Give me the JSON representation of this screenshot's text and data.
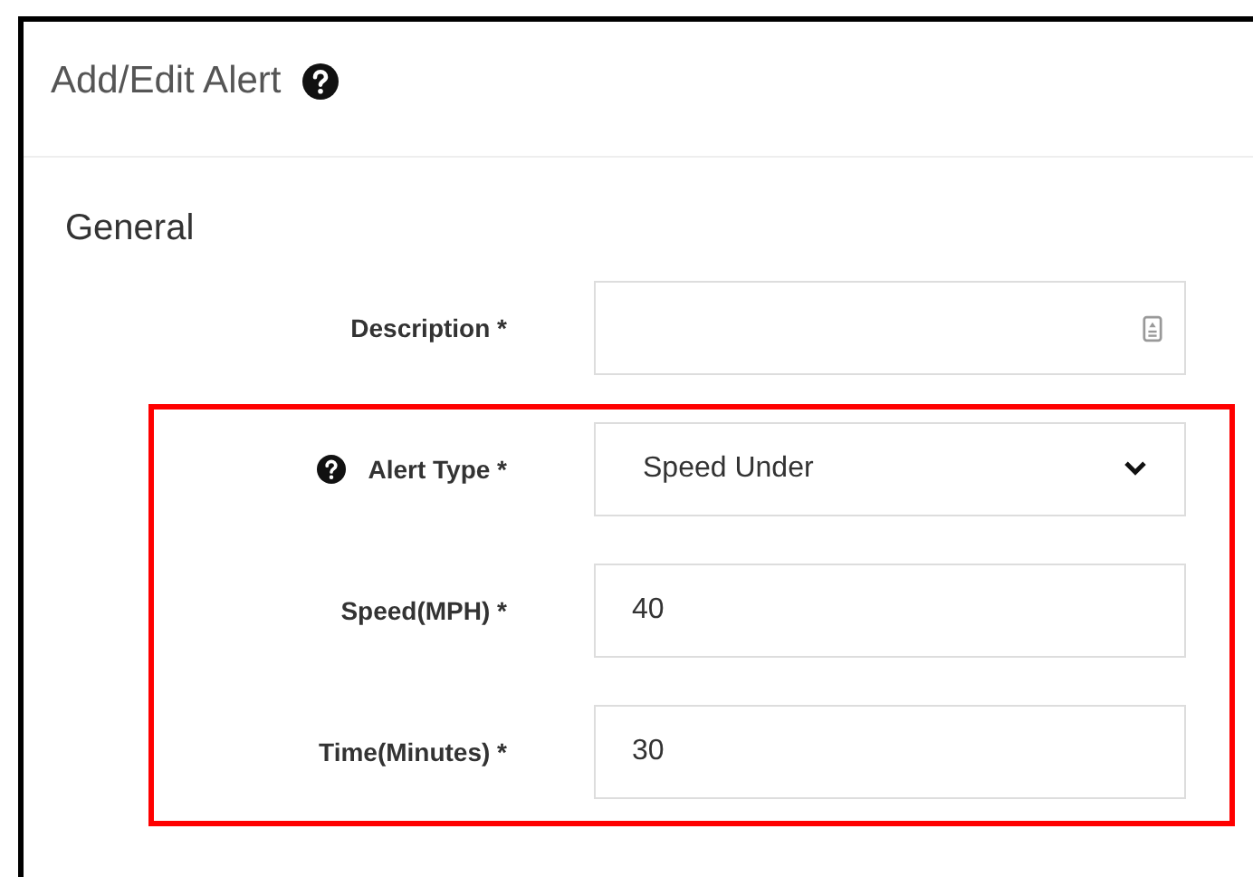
{
  "panel": {
    "title": "Add/Edit Alert",
    "help_icon": true
  },
  "section": {
    "title": "General"
  },
  "fields": [
    {
      "label": "Description *",
      "kind": "text",
      "help_icon": false,
      "trailing_icon": true
    }
  ],
  "highlighted_fields": [
    {
      "label": "Alert Type *",
      "kind": "select",
      "value": "Speed Under",
      "help_icon": true
    },
    {
      "label": "Speed(MPH) *",
      "kind": "text",
      "value": "40",
      "help_icon": false,
      "trailing_icon": false
    },
    {
      "label": "Time(Minutes) *",
      "kind": "text",
      "value": "30",
      "help_icon": false,
      "trailing_icon": false
    }
  ]
}
